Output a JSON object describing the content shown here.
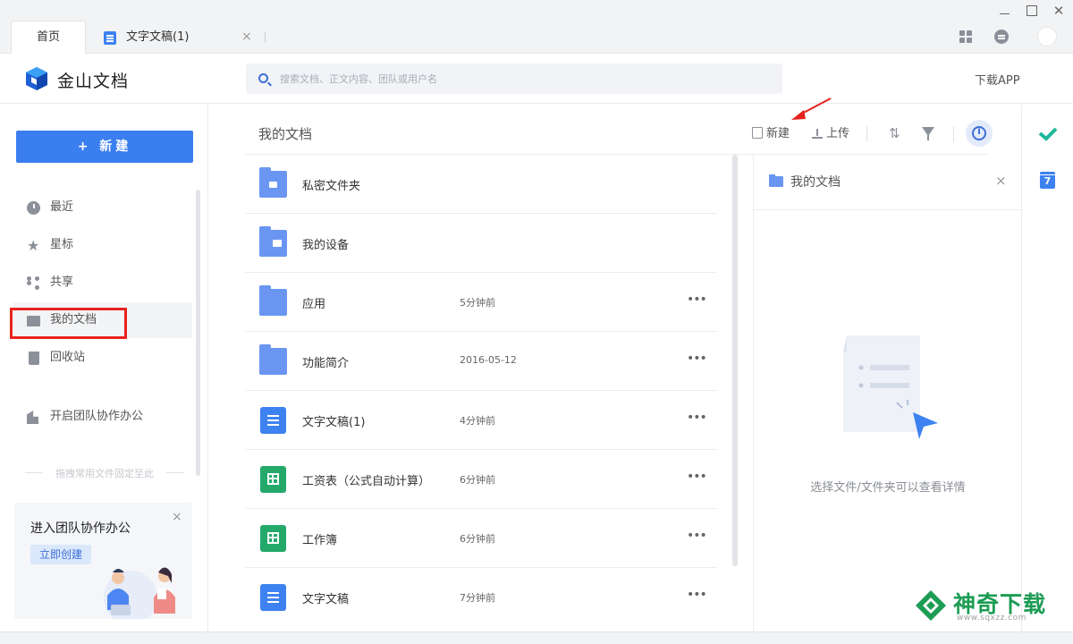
{
  "tabs": [
    {
      "label": "首页",
      "active": true
    },
    {
      "label": "文字文稿(1)",
      "active": false,
      "close": "×"
    }
  ],
  "window": {
    "close": "✕"
  },
  "header": {
    "logo_text": "金山文档",
    "search_placeholder": "搜索文档、正文内容、团队或用户名",
    "download_app": "下载APP"
  },
  "sidebar": {
    "new_button": "+ 新建",
    "items": [
      {
        "label": "最近",
        "icon": "clock-icon"
      },
      {
        "label": "星标",
        "icon": "star-icon"
      },
      {
        "label": "共享",
        "icon": "share-icon"
      },
      {
        "label": "我的文档",
        "icon": "folder-icon",
        "active": true
      },
      {
        "label": "回收站",
        "icon": "trash-icon"
      }
    ],
    "team_item": "开启团队协作办公",
    "pin_hint": "拖拽常用文件固定至此",
    "promo": {
      "title": "进入团队协作办公",
      "button": "立即创建",
      "close": "×"
    }
  },
  "main": {
    "title": "我的文档",
    "toolbar": {
      "new": "新建",
      "upload": "上传"
    },
    "files": [
      {
        "name": "私密文件夹",
        "time": "",
        "type": "folder-lock",
        "more": ""
      },
      {
        "name": "我的设备",
        "time": "",
        "type": "folder-device",
        "more": ""
      },
      {
        "name": "应用",
        "time": "5分钟前",
        "type": "folder",
        "more": "•••"
      },
      {
        "name": "功能简介",
        "time": "2016-05-12",
        "type": "folder",
        "more": "•••"
      },
      {
        "name": "文字文稿(1)",
        "time": "4分钟前",
        "type": "doc",
        "more": "•••"
      },
      {
        "name": "工资表（公式自动计算）",
        "time": "6分钟前",
        "type": "sheet",
        "more": "•••"
      },
      {
        "name": "工作簿",
        "time": "6分钟前",
        "type": "sheet",
        "more": "•••"
      },
      {
        "name": "文字文稿",
        "time": "7分钟前",
        "type": "doc",
        "more": "•••"
      }
    ]
  },
  "detail": {
    "title": "我的文档",
    "close": "×",
    "empty_text": "选择文件/文件夹可以查看详情"
  },
  "right_rail": {
    "calendar_day": "7"
  },
  "watermark": {
    "text": "神奇下载",
    "url": "www.sqxzz.com"
  },
  "colors": {
    "accent": "#3b7ef0",
    "highlight_box": "#e8231f",
    "sheet_green": "#24a96b",
    "doc_blue": "#3d82f0"
  }
}
